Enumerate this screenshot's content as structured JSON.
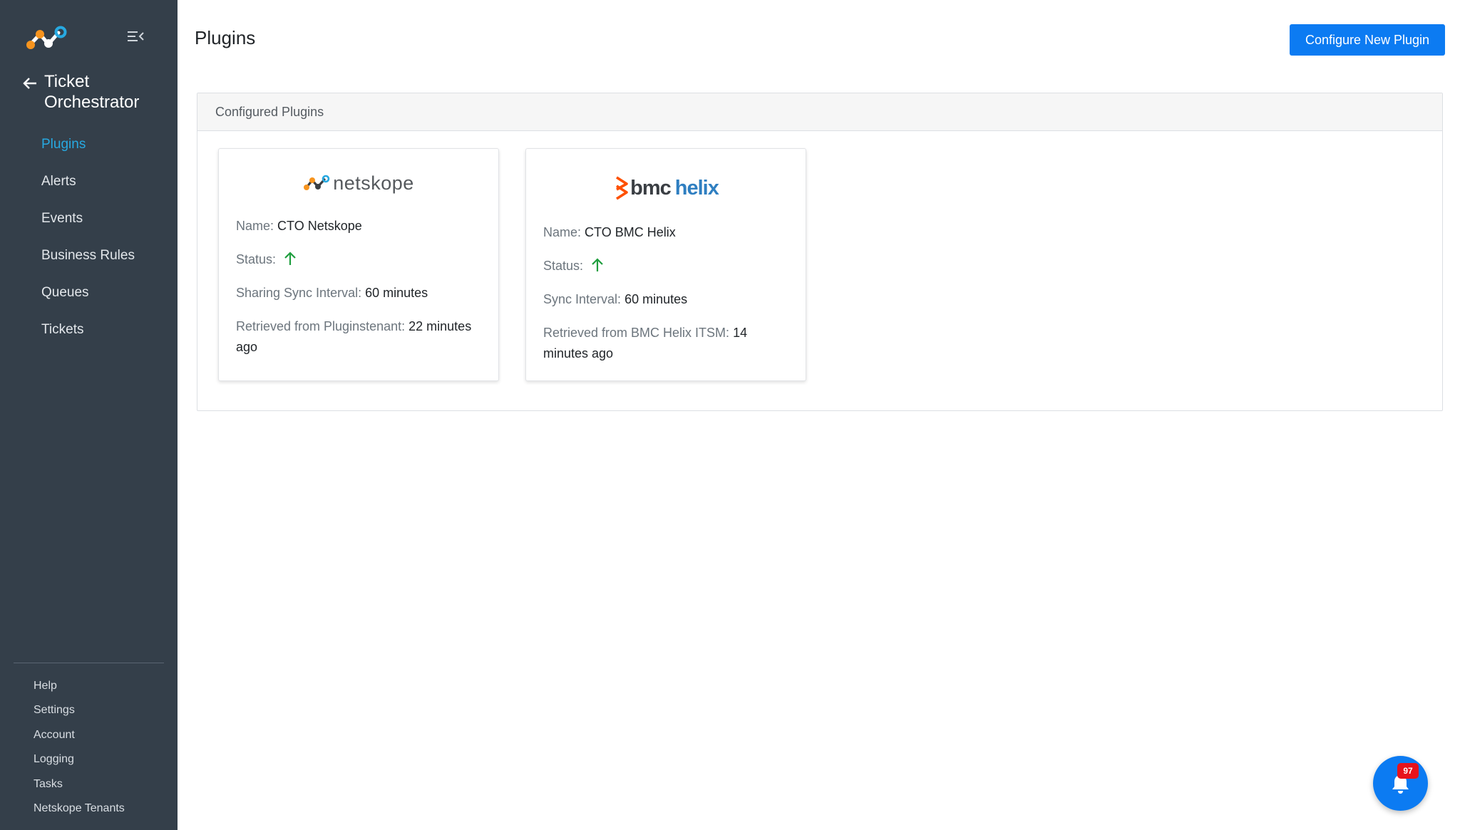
{
  "sidebar": {
    "app_title": "Ticket Orchestrator",
    "nav_items": [
      {
        "label": "Plugins",
        "active": true
      },
      {
        "label": "Alerts"
      },
      {
        "label": "Events"
      },
      {
        "label": "Business Rules"
      },
      {
        "label": "Queues"
      },
      {
        "label": "Tickets"
      }
    ],
    "bottom_items": [
      {
        "label": "Help"
      },
      {
        "label": "Settings"
      },
      {
        "label": "Account"
      },
      {
        "label": "Logging"
      },
      {
        "label": "Tasks"
      },
      {
        "label": "Netskope Tenants"
      }
    ]
  },
  "header": {
    "title": "Plugins",
    "configure_button": "Configure New Plugin"
  },
  "panel": {
    "title": "Configured Plugins",
    "cards": [
      {
        "logo": {
          "icon": "netskope-logo-icon",
          "text": "netskope"
        },
        "name_label": "Name:",
        "name_value": "CTO Netskope",
        "status_label": "Status:",
        "status_icon": "arrow-up-icon",
        "interval_label": "Sharing Sync Interval:",
        "interval_value": "60 minutes",
        "retrieved_label": "Retrieved from Pluginstenant:",
        "retrieved_value": "22 minutes ago"
      },
      {
        "logo": {
          "icon": "bmc-logo-icon",
          "text_bmc": "bmc",
          "text_helix": "helix"
        },
        "name_label": "Name:",
        "name_value": "CTO BMC Helix",
        "status_label": "Status:",
        "status_icon": "arrow-up-icon",
        "interval_label": "Sync Interval:",
        "interval_value": "60 minutes",
        "retrieved_label": "Retrieved from BMC Helix ITSM:",
        "retrieved_value": "14 minutes ago"
      }
    ]
  },
  "notifications": {
    "icon": "bell-icon",
    "count": "97"
  },
  "colors": {
    "sidebar_bg": "#343f4a",
    "active_nav": "#27a9e1",
    "primary": "#0c7bf2",
    "status_up": "#1e9e3e",
    "badge": "#e8131c",
    "netskope_orange": "#f7941e",
    "netskope_blue": "#27a9e1",
    "bmc_orange": "#fe5000",
    "helix_blue": "#2f7fc1"
  }
}
